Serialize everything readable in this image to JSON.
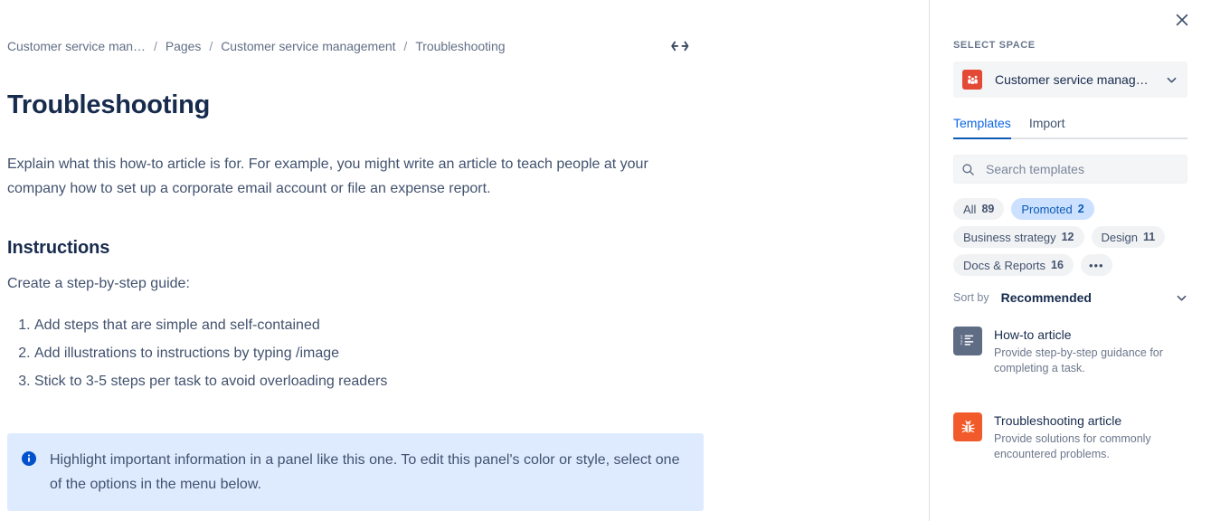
{
  "breadcrumb": {
    "items": [
      {
        "label": "Customer service man…",
        "truncated": true
      },
      {
        "label": "Pages",
        "truncated": false
      },
      {
        "label": "Customer service management",
        "truncated": false
      },
      {
        "label": "Troubleshooting",
        "truncated": false
      }
    ],
    "separator": "/",
    "expand_icon": "left-right-arrows-icon"
  },
  "document": {
    "title": "Troubleshooting",
    "intro": "Explain what this how-to article is for. For example, you might write an article to teach people at your company how to set up a corporate email account or file an expense report.",
    "section_title": "Instructions",
    "lead": "Create a step-by-step guide:",
    "steps": [
      "Add steps that are simple and self-contained",
      "Add illustrations to instructions by typing /image",
      "Stick to 3-5 steps per task to avoid overloading readers"
    ],
    "info_panel": {
      "icon": "info-icon",
      "text": "Highlight important information in a panel like this one. To edit this panel's color or style, select one of the options in the menu below.",
      "background": "#deebff",
      "icon_color": "#0052cc"
    }
  },
  "panel": {
    "close_icon": "close-icon",
    "select_space_label": "SELECT SPACE",
    "space": {
      "name": "Customer service manag…",
      "avatar_icon": "people-group-icon",
      "avatar_color": "#e34935",
      "chevron_icon": "chevron-down-icon"
    },
    "tabs": [
      {
        "label": "Templates",
        "active": true
      },
      {
        "label": "Import",
        "active": false
      }
    ],
    "search": {
      "placeholder": "Search templates",
      "value": "",
      "icon": "search-icon"
    },
    "filters": [
      {
        "label": "All",
        "count": "89",
        "selected": false
      },
      {
        "label": "Promoted",
        "count": "2",
        "selected": true
      },
      {
        "label": "Business strategy",
        "count": "12",
        "selected": false
      },
      {
        "label": "Design",
        "count": "11",
        "selected": false
      },
      {
        "label": "Docs & Reports",
        "count": "16",
        "selected": false
      }
    ],
    "more_filters_label": "•••",
    "sort": {
      "label": "Sort by",
      "value": "Recommended",
      "chevron_icon": "chevron-down-icon"
    },
    "templates": [
      {
        "title": "How-to article",
        "description": "Provide step-by-step guidance for completing a task.",
        "icon": "ordered-list-icon",
        "icon_bg": "#5e6c84"
      },
      {
        "title": "Troubleshooting article",
        "description": "Provide solutions for commonly encountered problems.",
        "icon": "bug-icon",
        "icon_bg": "#f15b2b"
      }
    ]
  },
  "colors": {
    "accent": "#0c66e4",
    "text_primary": "#172b4d",
    "text_secondary": "#42526e",
    "text_muted": "#6b778c",
    "panel_bg": "#f4f5f7",
    "divider": "#dfe1e6"
  }
}
